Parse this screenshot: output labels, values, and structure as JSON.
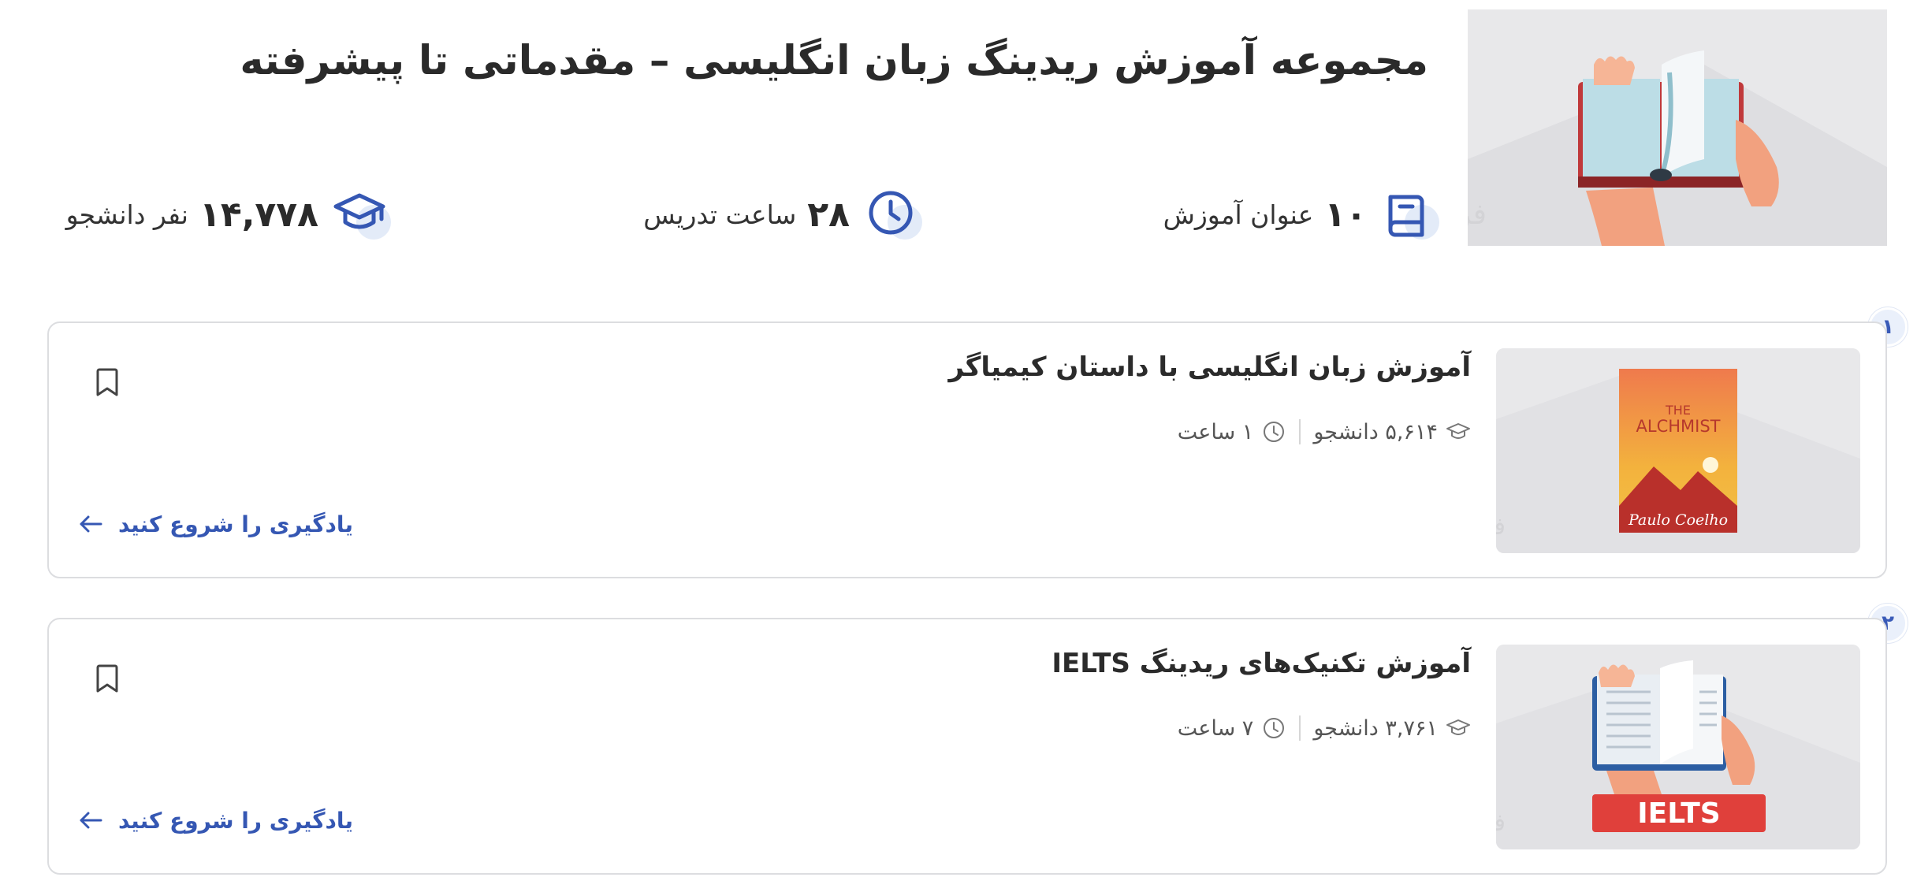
{
  "header": {
    "title": "مجموعه آموزش ریدینگ زبان انگلیسی – مقدماتی تا پیشرفته",
    "image_watermark": "فرادرس",
    "hero_icon": "open-book-in-hands-illustration"
  },
  "stats": {
    "titles": {
      "value": "۱۰",
      "label": "عنوان آموزش",
      "icon": "book-icon"
    },
    "hours": {
      "value": "۲۸",
      "label": "ساعت تدریس",
      "icon": "clock-icon"
    },
    "students": {
      "value": "۱۴,۷۷۸",
      "label": "نفر دانشجو",
      "icon": "graduation-cap-icon"
    }
  },
  "courses": [
    {
      "index": "۱",
      "title": "آموزش زبان انگلیسی با داستان کیمیاگر",
      "students": "۵,۶۱۴ دانشجو",
      "duration": "۱ ساعت",
      "start_label": "یادگیری را شروع کنید",
      "thumb": {
        "cover_top": "THE",
        "cover_title": "ALCHMIST",
        "cover_author": "Paulo Coelho",
        "watermark": "فرادرس"
      }
    },
    {
      "index": "۲",
      "title": "آموزش تکنیک‌های ریدینگ IELTS",
      "students": "۳,۷۶۱ دانشجو",
      "duration": "۷ ساعت",
      "start_label": "یادگیری را شروع کنید",
      "thumb": {
        "banner": "IELTS",
        "watermark": "فرادرس"
      }
    }
  ],
  "colors": {
    "accent": "#3557b3",
    "icon_bubble": "#e3ebf8",
    "card_border": "#dcdde0",
    "thumb_bg": "#e8e8ea"
  }
}
